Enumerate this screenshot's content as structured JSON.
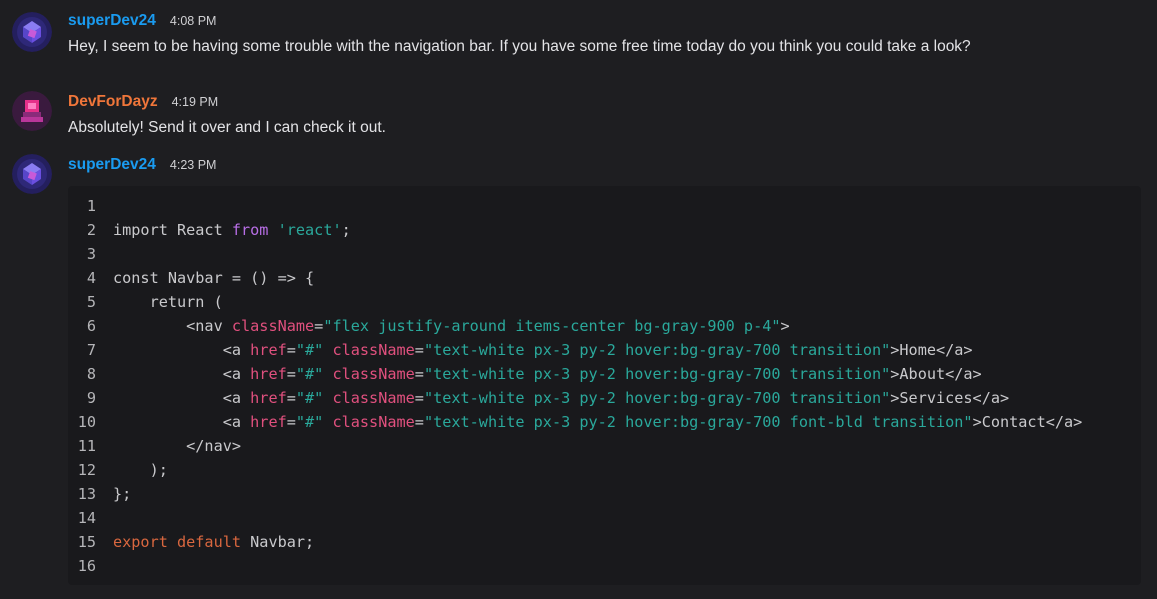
{
  "messages": [
    {
      "username": "superDev24",
      "username_color": "#1a9bf0",
      "time": "4:08 PM",
      "text": "Hey, I seem to be having some trouble with the navigation bar. If you have some free time today do you think you could take a look?",
      "avatar": "cube-avatar-icon"
    },
    {
      "username": "DevForDayz",
      "username_color": "#f0763a",
      "time": "4:19 PM",
      "text": "Absolutely! Send it over and I can check it out.",
      "avatar": "pink-avatar-icon"
    },
    {
      "username": "superDev24",
      "username_color": "#1a9bf0",
      "time": "4:23 PM",
      "avatar": "cube-avatar-icon"
    }
  ],
  "code": {
    "lines": [
      {
        "n": "1",
        "tokens": []
      },
      {
        "n": "2",
        "tokens": [
          {
            "t": "import React ",
            "c": "plain"
          },
          {
            "t": "from",
            "c": "kw"
          },
          {
            "t": " ",
            "c": "plain"
          },
          {
            "t": "'react'",
            "c": "str"
          },
          {
            "t": ";",
            "c": "plain"
          }
        ]
      },
      {
        "n": "3",
        "tokens": []
      },
      {
        "n": "4",
        "tokens": [
          {
            "t": "const Navbar = () => {",
            "c": "plain"
          }
        ]
      },
      {
        "n": "5",
        "tokens": [
          {
            "t": "    return (",
            "c": "plain"
          }
        ]
      },
      {
        "n": "6",
        "tokens": [
          {
            "t": "        <nav ",
            "c": "plain"
          },
          {
            "t": "className",
            "c": "attr"
          },
          {
            "t": "=",
            "c": "plain"
          },
          {
            "t": "\"flex justify-around items-center bg-gray-900 p-4\"",
            "c": "str"
          },
          {
            "t": ">",
            "c": "plain"
          }
        ]
      },
      {
        "n": "7",
        "tokens": [
          {
            "t": "            <a ",
            "c": "plain"
          },
          {
            "t": "href",
            "c": "attr"
          },
          {
            "t": "=",
            "c": "plain"
          },
          {
            "t": "\"#\"",
            "c": "str"
          },
          {
            "t": " ",
            "c": "plain"
          },
          {
            "t": "className",
            "c": "attr"
          },
          {
            "t": "=",
            "c": "plain"
          },
          {
            "t": "\"text-white px-3 py-2 hover:bg-gray-700 transition\"",
            "c": "str"
          },
          {
            "t": ">Home</a>",
            "c": "plain"
          }
        ]
      },
      {
        "n": "8",
        "tokens": [
          {
            "t": "            <a ",
            "c": "plain"
          },
          {
            "t": "href",
            "c": "attr"
          },
          {
            "t": "=",
            "c": "plain"
          },
          {
            "t": "\"#\"",
            "c": "str"
          },
          {
            "t": " ",
            "c": "plain"
          },
          {
            "t": "className",
            "c": "attr"
          },
          {
            "t": "=",
            "c": "plain"
          },
          {
            "t": "\"text-white px-3 py-2 hover:bg-gray-700 transition\"",
            "c": "str"
          },
          {
            "t": ">About</a>",
            "c": "plain"
          }
        ]
      },
      {
        "n": "9",
        "tokens": [
          {
            "t": "            <a ",
            "c": "plain"
          },
          {
            "t": "href",
            "c": "attr"
          },
          {
            "t": "=",
            "c": "plain"
          },
          {
            "t": "\"#\"",
            "c": "str"
          },
          {
            "t": " ",
            "c": "plain"
          },
          {
            "t": "className",
            "c": "attr"
          },
          {
            "t": "=",
            "c": "plain"
          },
          {
            "t": "\"text-white px-3 py-2 hover:bg-gray-700 transition\"",
            "c": "str"
          },
          {
            "t": ">Services</a>",
            "c": "plain"
          }
        ]
      },
      {
        "n": "10",
        "tokens": [
          {
            "t": "            <a ",
            "c": "plain"
          },
          {
            "t": "href",
            "c": "attr"
          },
          {
            "t": "=",
            "c": "plain"
          },
          {
            "t": "\"#\"",
            "c": "str"
          },
          {
            "t": " ",
            "c": "plain"
          },
          {
            "t": "className",
            "c": "attr"
          },
          {
            "t": "=",
            "c": "plain"
          },
          {
            "t": "\"text-white px-3 py-2 hover:bg-gray-700 font-bld transition\"",
            "c": "str"
          },
          {
            "t": ">Contact</a>",
            "c": "plain"
          }
        ]
      },
      {
        "n": "11",
        "tokens": [
          {
            "t": "        </nav>",
            "c": "plain"
          }
        ]
      },
      {
        "n": "12",
        "tokens": [
          {
            "t": "    );",
            "c": "plain"
          }
        ]
      },
      {
        "n": "13",
        "tokens": [
          {
            "t": "};",
            "c": "plain"
          }
        ]
      },
      {
        "n": "14",
        "tokens": []
      },
      {
        "n": "15",
        "tokens": [
          {
            "t": "export default",
            "c": "export"
          },
          {
            "t": " Navbar;",
            "c": "plain"
          }
        ]
      },
      {
        "n": "16",
        "tokens": []
      }
    ]
  }
}
